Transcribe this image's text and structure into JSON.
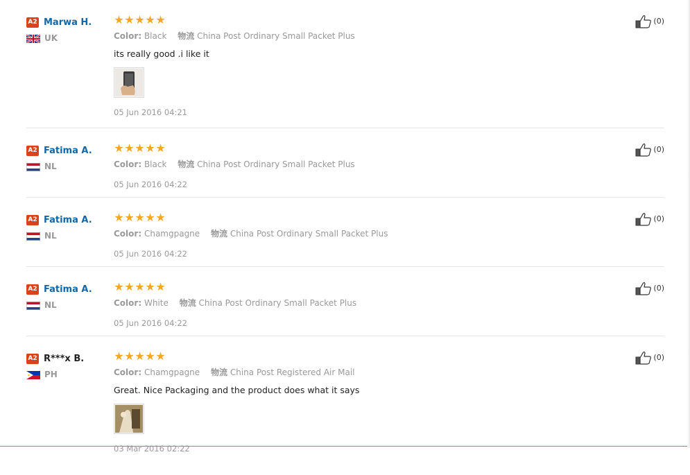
{
  "reviews": [
    {
      "level": "A2",
      "user": "Marwa H.",
      "country": "UK",
      "flag": "gb-flag-icon",
      "color_label": "Color:",
      "color": "Black",
      "shipping_label": "物流",
      "shipping": "China Post Ordinary Small Packet Plus",
      "text": "its really good .i like it",
      "date": "05 Jun 2016 04:21",
      "useful": "(0)",
      "rating": 5
    },
    {
      "level": "A2",
      "user": "Fatima A.",
      "country": "NL",
      "flag": "nl-flag-icon",
      "color_label": "Color:",
      "color": "Black",
      "shipping_label": "物流",
      "shipping": "China Post Ordinary Small Packet Plus",
      "date": "05 Jun 2016 04:22",
      "useful": "(0)",
      "rating": 5
    },
    {
      "level": "A2",
      "user": "Fatima A.",
      "country": "NL",
      "flag": "nl-flag-icon",
      "color_label": "Color:",
      "color": "Chamgpagne",
      "shipping_label": "物流",
      "shipping": "China Post Ordinary Small Packet Plus",
      "date": "05 Jun 2016 04:22",
      "useful": "(0)",
      "rating": 5
    },
    {
      "level": "A2",
      "user": "Fatima A.",
      "country": "NL",
      "flag": "nl-flag-icon",
      "color_label": "Color:",
      "color": "White",
      "shipping_label": "物流",
      "shipping": "China Post Ordinary Small Packet Plus",
      "date": "05 Jun 2016 04:22",
      "useful": "(0)",
      "rating": 5
    },
    {
      "level": "A2",
      "user": "R***x B.",
      "country": "PH",
      "flag": "ph-flag-icon",
      "color_label": "Color:",
      "color": "Chamgpagne",
      "shipping_label": "物流",
      "shipping": "China Post Registered Air Mail",
      "text": "Great. Nice Packaging and the product does what it says",
      "date": "03 Mar 2016 02:22",
      "useful": "(0)",
      "rating": 5
    }
  ],
  "colors": {
    "username": "#1466a5",
    "badge": "#d9421d",
    "star": "#f5a623",
    "muted": "#999999"
  },
  "icons": {
    "star": "star-icon",
    "thumbs_up": "thumbs-up-icon"
  }
}
